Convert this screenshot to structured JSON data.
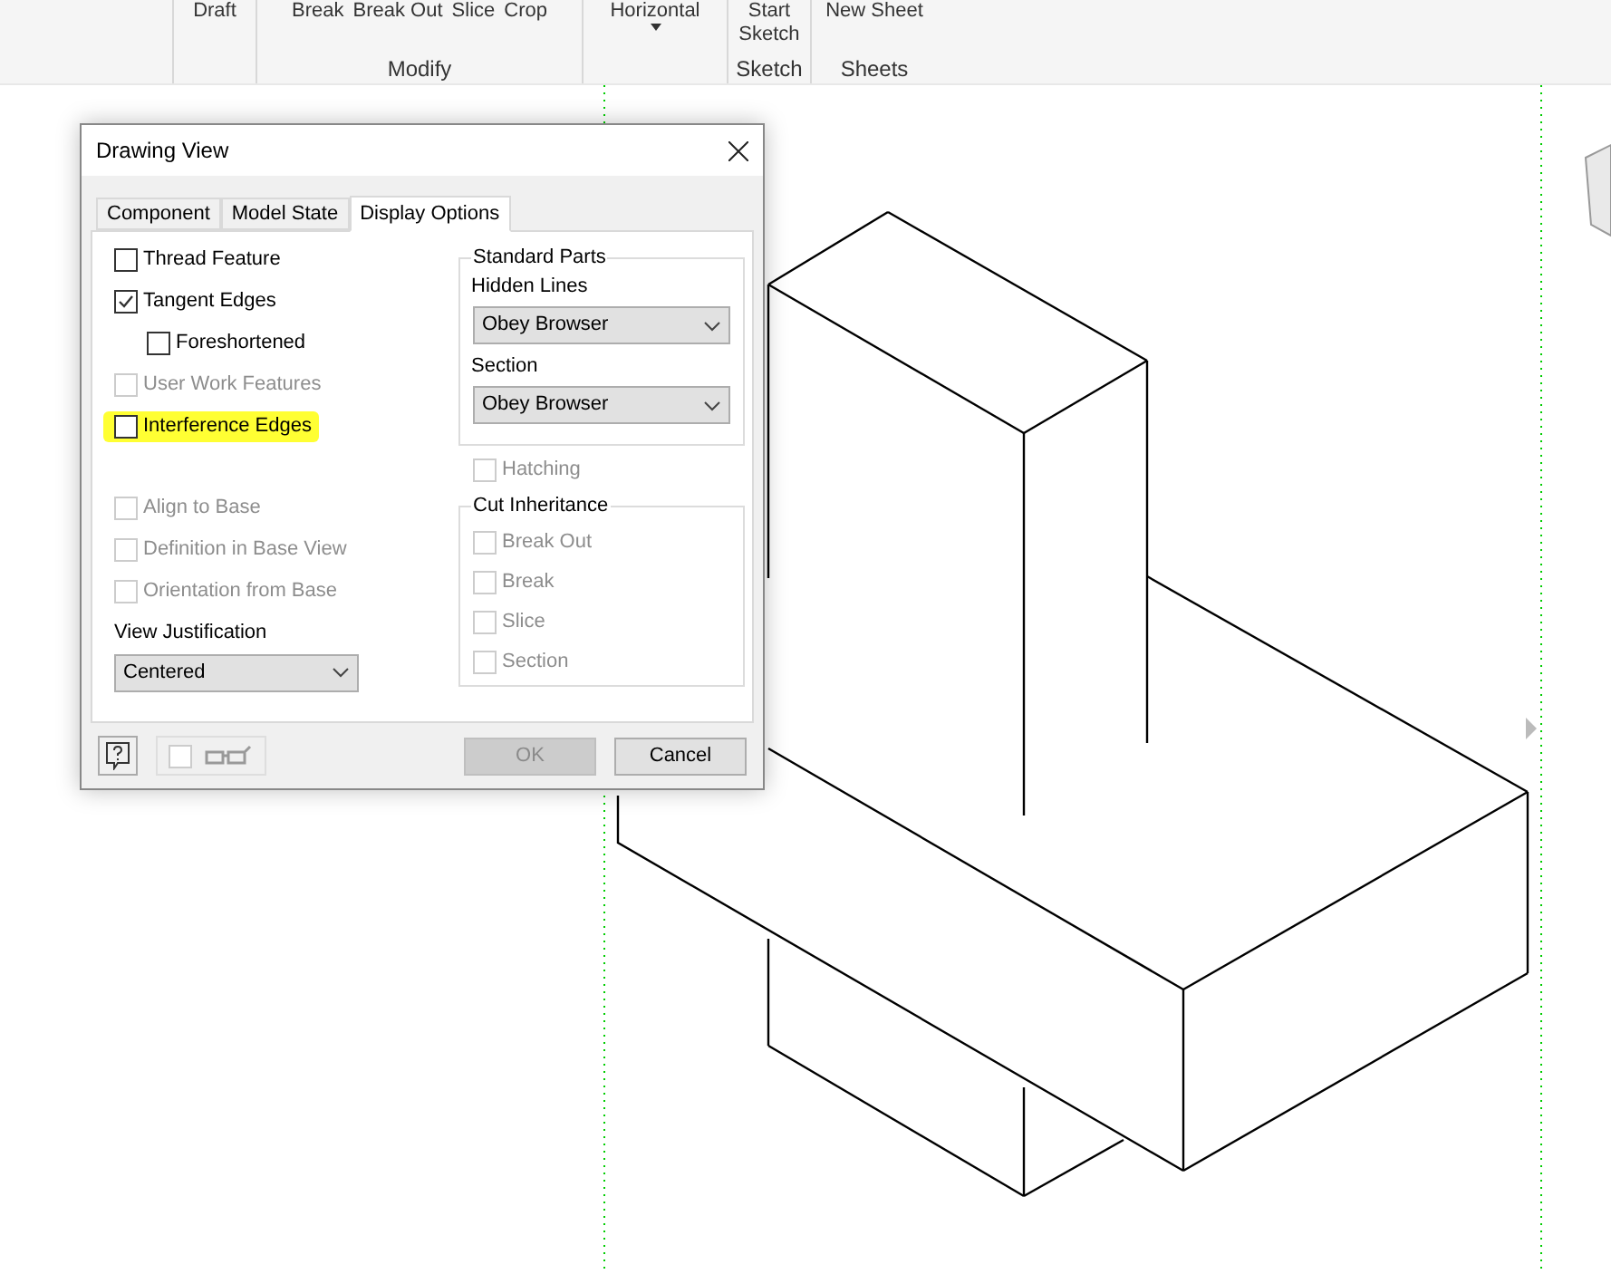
{
  "ribbon": {
    "groups": [
      {
        "buttons": [
          {
            "label": "Draft",
            "caret": false
          }
        ]
      },
      {
        "label": "Modify",
        "buttons": [
          {
            "label": "Break",
            "caret": false
          },
          {
            "label": "Break Out",
            "caret": false
          },
          {
            "label": "Slice",
            "caret": false
          },
          {
            "label": "Crop",
            "caret": false
          }
        ]
      },
      {
        "buttons": [
          {
            "label": "Horizontal",
            "caret": true
          }
        ]
      },
      {
        "label": "Sketch",
        "buttons": [
          {
            "label": "Start Sketch",
            "caret": false
          }
        ]
      },
      {
        "label": "Sheets",
        "buttons": [
          {
            "label": "New Sheet",
            "caret": false
          }
        ]
      }
    ]
  },
  "dialog": {
    "title": "Drawing View",
    "tabs": [
      {
        "label": "Component",
        "selected": false
      },
      {
        "label": "Model State",
        "selected": false
      },
      {
        "label": "Display Options",
        "selected": true
      }
    ],
    "options": [
      {
        "label": "Thread Feature",
        "checked": false,
        "disabled": false,
        "highlighted": false
      },
      {
        "label": "Tangent Edges",
        "checked": true,
        "disabled": false,
        "highlighted": false,
        "children": [
          {
            "label": "Foreshortened",
            "checked": false,
            "disabled": false,
            "highlighted": false
          }
        ]
      },
      {
        "label": "User Work Features",
        "checked": false,
        "disabled": true,
        "highlighted": false
      },
      {
        "label": "Interference Edges",
        "checked": false,
        "disabled": false,
        "highlighted": true
      }
    ],
    "base_options": [
      {
        "label": "Align to Base",
        "checked": false,
        "disabled": true
      },
      {
        "label": "Definition in Base View",
        "checked": false,
        "disabled": true
      },
      {
        "label": "Orientation from Base",
        "checked": false,
        "disabled": true
      }
    ],
    "view_justification": {
      "label": "View Justification",
      "value": "Centered"
    },
    "standard_parts": {
      "title": "Standard Parts",
      "fields": [
        {
          "label": "Hidden Lines",
          "value": "Obey Browser"
        },
        {
          "label": "Section",
          "value": "Obey Browser"
        }
      ]
    },
    "hatching": {
      "label": "Hatching",
      "checked": false,
      "disabled": true
    },
    "cut_inheritance": {
      "title": "Cut Inheritance",
      "items": [
        {
          "label": "Break Out",
          "checked": false,
          "disabled": true
        },
        {
          "label": "Break",
          "checked": false,
          "disabled": true
        },
        {
          "label": "Slice",
          "checked": false,
          "disabled": true
        },
        {
          "label": "Section",
          "checked": false,
          "disabled": true
        }
      ]
    },
    "preview": {
      "checked": false
    },
    "buttons": [
      {
        "label": "OK",
        "disabled": true
      },
      {
        "label": "Cancel",
        "disabled": false
      }
    ]
  }
}
